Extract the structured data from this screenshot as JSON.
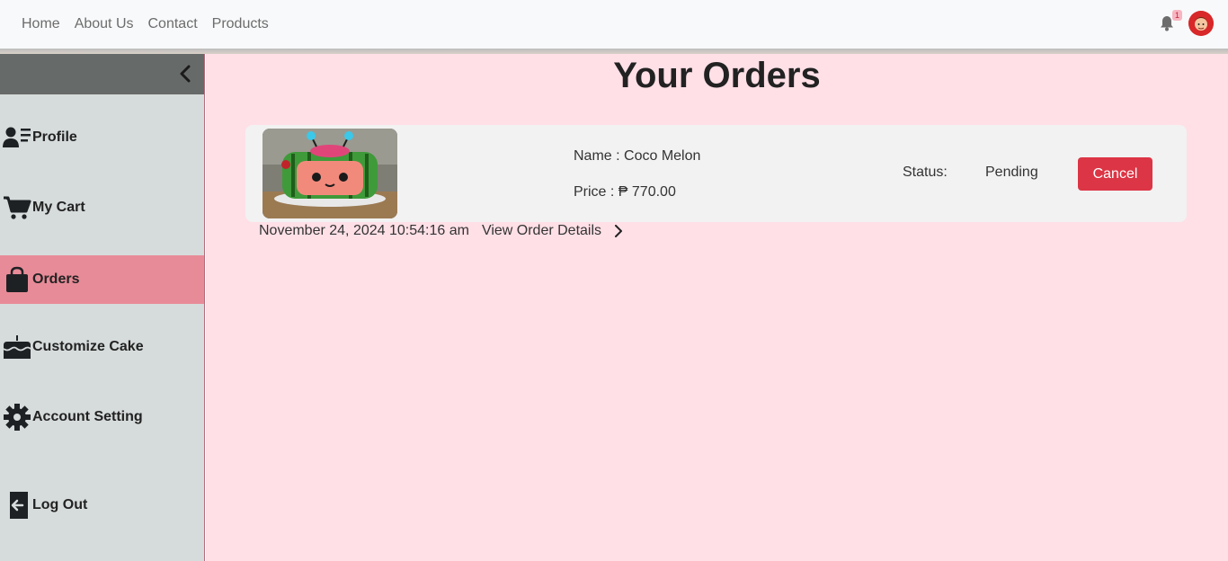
{
  "nav": {
    "links": [
      "Home",
      "About Us",
      "Contact",
      "Products"
    ],
    "notification_count": "1"
  },
  "sidebar": {
    "items": [
      {
        "label": "Profile",
        "icon": "user-list-icon"
      },
      {
        "label": "My Cart",
        "icon": "cart-icon"
      },
      {
        "label": "Orders",
        "icon": "shopping-bag-icon",
        "active": true
      },
      {
        "label": "Customize Cake",
        "icon": "cake-icon"
      },
      {
        "label": "Account Setting",
        "icon": "gear-icon"
      },
      {
        "label": "Log Out",
        "icon": "logout-icon"
      }
    ]
  },
  "main": {
    "title": "Your Orders",
    "order": {
      "name": "Name : Coco Melon",
      "price": "Price : ₱ 770.00",
      "status_label": "Status:",
      "status_value": "Pending",
      "cancel_label": "Cancel",
      "date": "November 24, 2024 10:54:16 am",
      "details_label": "View Order Details"
    }
  },
  "colors": {
    "accent_active": "#e88b98",
    "cancel": "#dc3545",
    "main_bg": "#ffe0e7",
    "sidebar_bg": "#d6dbdb"
  }
}
